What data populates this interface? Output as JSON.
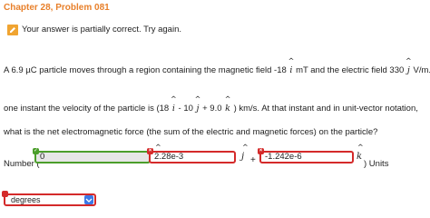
{
  "header": {
    "title": "Chapter 28, Problem 081"
  },
  "status": {
    "message": "Your answer is partially correct.  Try again."
  },
  "problem": {
    "line1_a": "A 6.9 µC particle moves through a region containing the magnetic field -18",
    "line1_unit_i": "i",
    "line1_b": "mT and the electric field 330",
    "line1_unit_j": "j",
    "line1_c": "V/m. At",
    "line2_a": "one instant the velocity of the particle is (18",
    "line2_unit_i": "i",
    "line2_b": "- 10",
    "line2_unit_j": "j",
    "line2_c": "+ 9.0",
    "line2_unit_k": "k",
    "line2_d": ") km/s. At that instant and in unit-vector notation,",
    "line3": "what is the net electromagnetic force (the sum of the electric and magnetic forces) on the particle?"
  },
  "answer": {
    "number_label": "Number (",
    "field_i": {
      "value": "0",
      "unit": "i"
    },
    "plus1": "+",
    "field_j": {
      "value": "2.28e-3",
      "unit": "j"
    },
    "plus2": "+",
    "field_k": {
      "value": "-1.242e-6",
      "unit": "k"
    },
    "closing": ") Units"
  },
  "units_select": {
    "value": "degrees"
  },
  "colors": {
    "chapter_title": "#e8802b",
    "correct_border": "#4b9e2b",
    "wrong_border": "#d42a2a",
    "select_arrow": "#3b78e7"
  }
}
